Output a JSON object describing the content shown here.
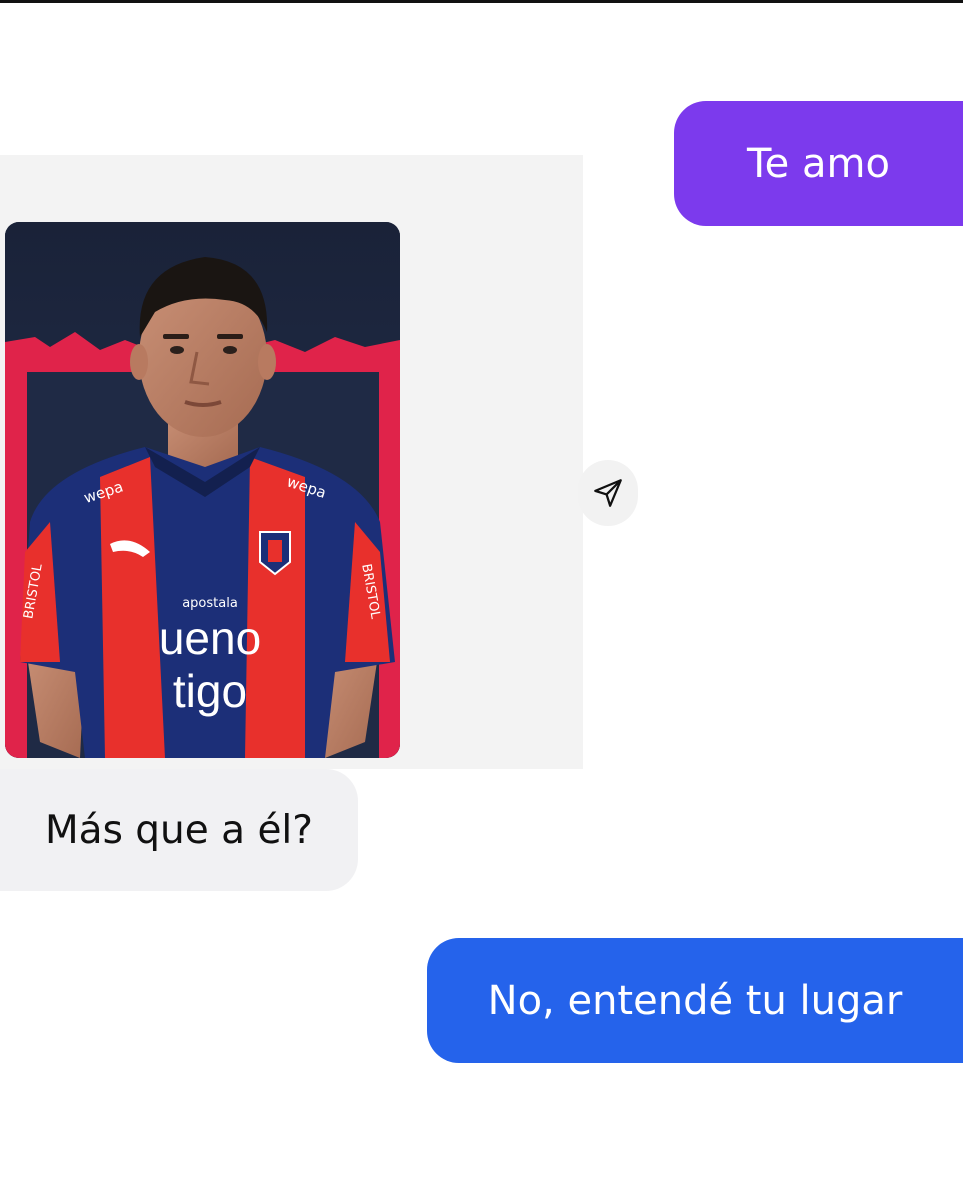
{
  "messages": [
    {
      "side": "outgoing",
      "text": "Te amo",
      "color": "#7c3aed"
    },
    {
      "side": "incoming",
      "text": "Más que a él?",
      "color": "#f1f1f3"
    },
    {
      "side": "outgoing",
      "text": "No, entendé tu lugar",
      "color": "#2563eb"
    }
  ],
  "shared_post": {
    "image": "football-player-portrait",
    "logo_text": {
      "sponsor_top": "ueno",
      "sponsor_bottom": "tigo",
      "kit_brand": "wepa",
      "small_sponsor": "apostala",
      "sleeve": "BRISTOL"
    }
  },
  "icons": {
    "forward": "paper-plane-icon"
  },
  "colors": {
    "outgoing_purple": "#7c3aed",
    "outgoing_blue": "#2563eb",
    "incoming_gray": "#f1f1f3"
  }
}
